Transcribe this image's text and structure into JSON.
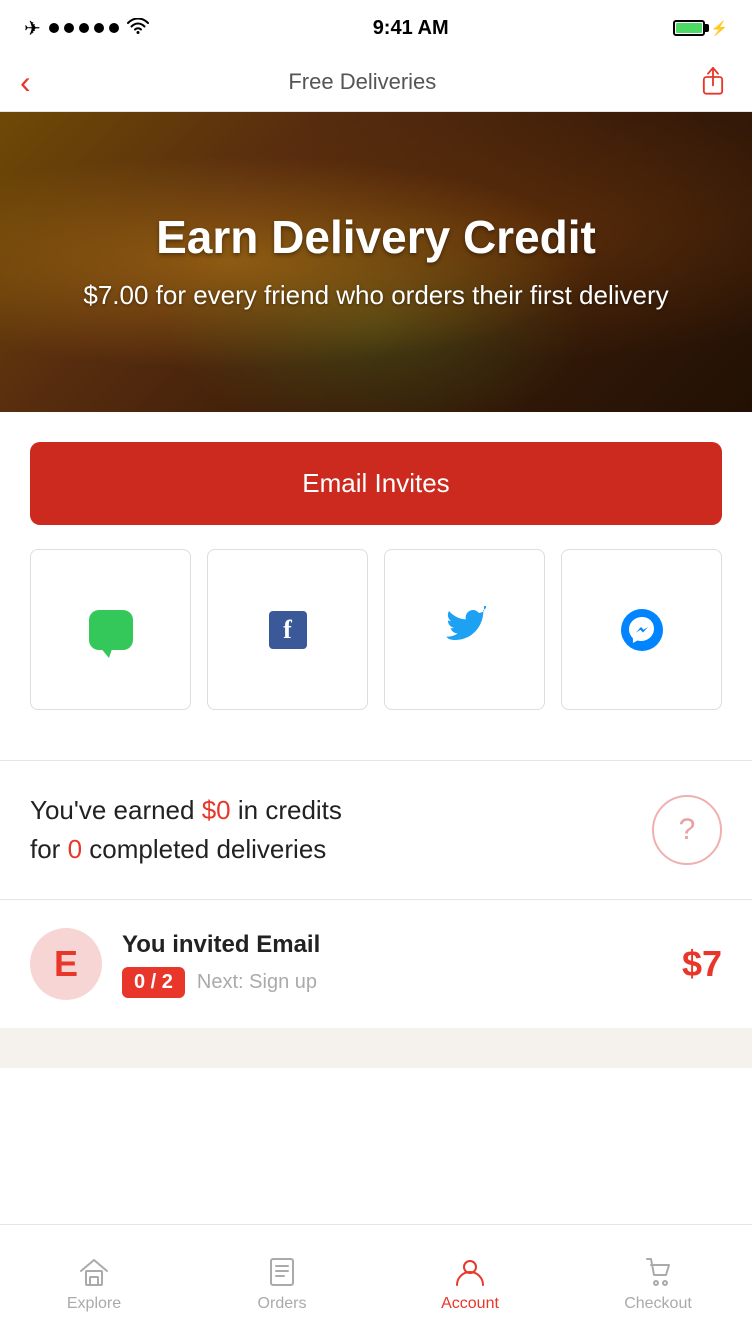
{
  "statusBar": {
    "time": "9:41 AM",
    "batteryColor": "#4cd964"
  },
  "navBar": {
    "title": "Free Deliveries",
    "backLabel": "<",
    "shareLabel": "share"
  },
  "hero": {
    "title": "Earn Delivery Credit",
    "subtitle": "$7.00 for every friend who orders their first delivery"
  },
  "buttons": {
    "emailInvites": "Email Invites"
  },
  "social": {
    "sms": "SMS",
    "facebook": "Facebook",
    "twitter": "Twitter",
    "messenger": "Messenger"
  },
  "credits": {
    "earned": "$0",
    "count": "0",
    "text_before": "You've earned ",
    "text_middle": " in credits",
    "text_before2": "for ",
    "text_after2": " completed deliveries",
    "helpLabel": "?"
  },
  "invite": {
    "avatarLetter": "E",
    "title": "You invited Email",
    "progress": "0 / 2",
    "next": "Next: Sign up",
    "reward": "$7"
  },
  "tabBar": {
    "items": [
      {
        "label": "Explore",
        "icon": "home-icon",
        "active": false
      },
      {
        "label": "Orders",
        "icon": "orders-icon",
        "active": false
      },
      {
        "label": "Account",
        "icon": "account-icon",
        "active": true
      },
      {
        "label": "Checkout",
        "icon": "checkout-icon",
        "active": false
      }
    ]
  }
}
